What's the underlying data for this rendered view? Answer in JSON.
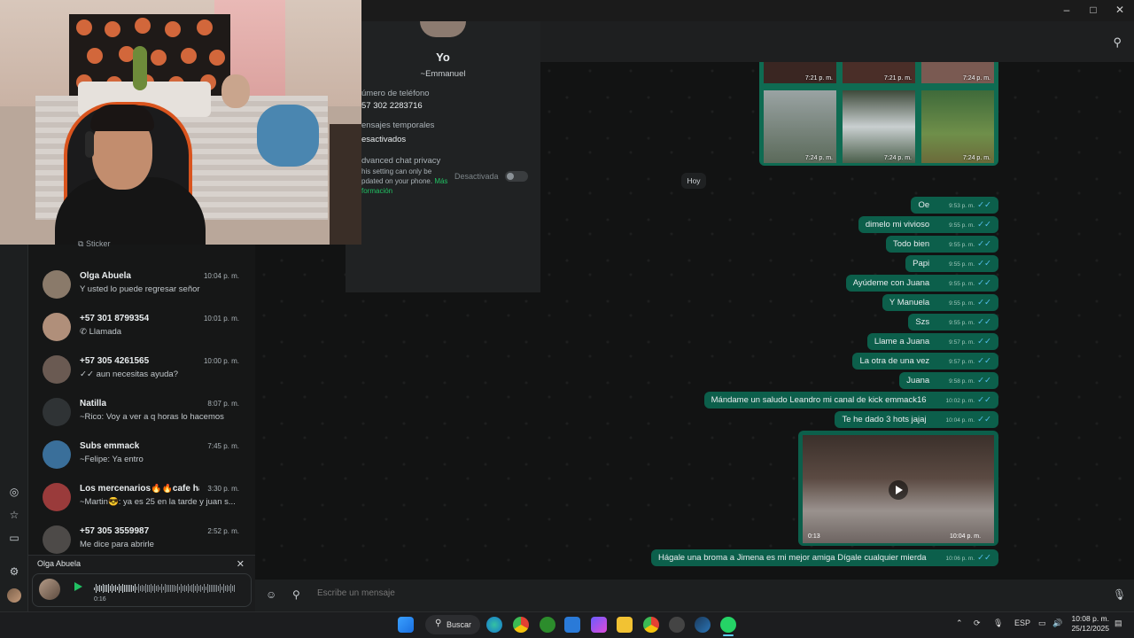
{
  "window": {
    "minimize": "–",
    "maximize": "□",
    "close": "✕"
  },
  "contact_panel": {
    "name": "Yo",
    "subtitle": "~Emmanuel",
    "phone_label": "úmero de teléfono",
    "phone_value": "57 302 2283716",
    "temp_label": "ensajes temporales",
    "temp_value": "esactivados",
    "privacy_label": "dvanced chat privacy",
    "privacy_desc": "his setting can only be\npdated on your phone.",
    "privacy_link": "Más formación",
    "privacy_toggle_label": "Desactivada"
  },
  "chat_list": {
    "sticker_preview": "Sticker",
    "items": [
      {
        "name": "Olga Abuela",
        "time": "10:04 p. m.",
        "preview": "Y  usted lo puede regresar señor",
        "avatar_color": "#8a7a6a"
      },
      {
        "name": "+57 301 8799354",
        "time": "10:01 p. m.",
        "preview": "Llamada",
        "avatar_color": "#b08f7a"
      },
      {
        "name": "+57 305 4261565",
        "time": "10:00 p. m.",
        "preview": "aun necesitas ayuda?",
        "avatar_color": "#6a5a52"
      },
      {
        "name": "Natilla",
        "time": "8:07 p. m.",
        "preview": "~Rico: Voy a ver a q horas lo hacemos",
        "avatar_color": "#2f3335"
      },
      {
        "name": "Subs emmack",
        "time": "7:45 p. m.",
        "preview": "~Felipe: Ya entro",
        "avatar_color": "#3a6f9a"
      },
      {
        "name": "Los mercenarios🔥🔥cafe ha...",
        "time": "3:30 p. m.",
        "preview": "~Martin😎: ya es 25 en la tarde y juan s...",
        "avatar_color": "#9a3b3b"
      },
      {
        "name": "+57 305 3559987",
        "time": "2:52 p. m.",
        "preview": "Me dice para abrirle",
        "avatar_color": "#4d4a48"
      }
    ]
  },
  "audio_player": {
    "title": "Olga Abuela",
    "duration": "0:16",
    "close": "✕",
    "progress": 0.3
  },
  "gallery": {
    "times": [
      "7:21 p. m.",
      "7:21 p. m.",
      "7:24 p. m.",
      "7:24 p. m.",
      "7:24 p. m.",
      "7:24 p. m."
    ]
  },
  "day_divider": "Hoy",
  "messages": [
    {
      "text": "Oe",
      "time": "9:53 p. m."
    },
    {
      "text": "dimelo mi vivioso",
      "time": "9:55 p. m."
    },
    {
      "text": "Todo bien",
      "time": "9:55 p. m."
    },
    {
      "text": "Papi",
      "time": "9:55 p. m."
    },
    {
      "text": "Ayúdeme con Juana",
      "time": "9:55 p. m."
    },
    {
      "text": "Y Manuela",
      "time": "9:55 p. m."
    },
    {
      "text": "Szs",
      "time": "9:55 p. m."
    },
    {
      "text": "Llame a Juana",
      "time": "9:57 p. m."
    },
    {
      "text": "La otra de una vez",
      "time": "9:57 p. m."
    },
    {
      "text": "Juana",
      "time": "9:58 p. m."
    },
    {
      "text": "Mándame un saludo Leandro mi canal de kick emmack16",
      "time": "10:02 p. m."
    },
    {
      "text": "Te he dado 3 hots jajaj",
      "time": "10:04 p. m."
    }
  ],
  "video_message": {
    "duration": "0:13",
    "time": "10:04 p. m."
  },
  "last_message": {
    "text": "Hágale una broma a Jimena es mi mejor amiga Dígale cualquier mierda",
    "time": "10:06 p. m."
  },
  "composer": {
    "placeholder": "Escribe un mensaje"
  },
  "taskbar": {
    "search_label": "Buscar",
    "language": "ESP",
    "clock_time": "10:08 p. m.",
    "clock_date": "25/12/2025"
  },
  "colors": {
    "accent": "#21c063",
    "outgoing_bubble": "#0c5f4b",
    "chat_bg": "#121313"
  }
}
